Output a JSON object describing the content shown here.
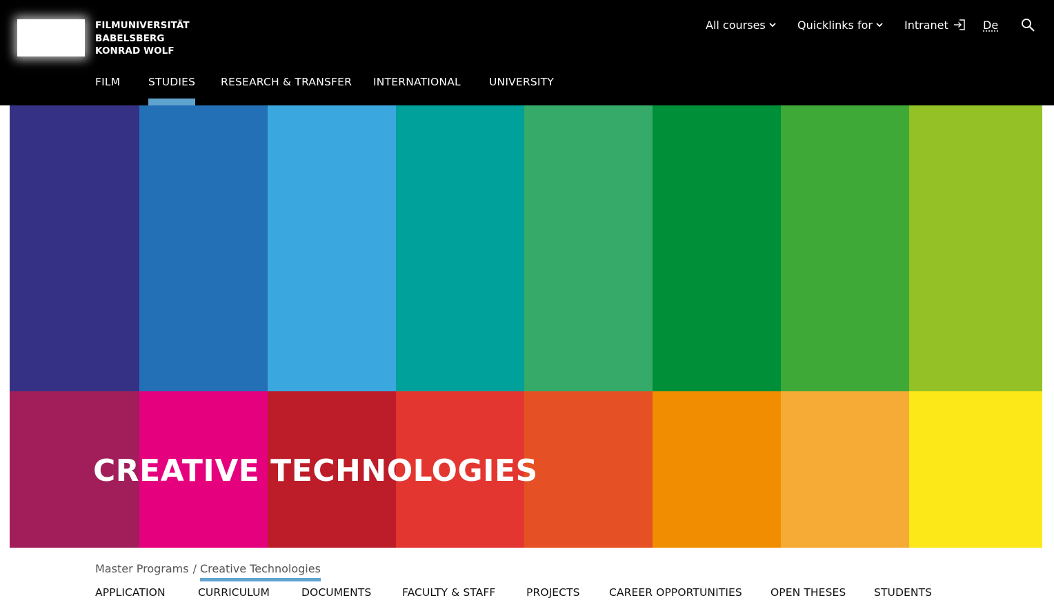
{
  "brand": {
    "line1": "FILMUNIVERSITÄT",
    "line2": "BABELSBERG",
    "line3": "KONRAD WOLF"
  },
  "utility_nav": {
    "all_courses": "All courses",
    "quicklinks": "Quicklinks for",
    "intranet": "Intranet",
    "language": "De",
    "icons": {
      "dropdown": "chevron-down-icon",
      "intranet": "login-icon",
      "search": "search-icon"
    }
  },
  "main_nav": {
    "items": [
      {
        "label": "FILM",
        "active": false
      },
      {
        "label": "STUDIES",
        "active": true
      },
      {
        "label": "RESEARCH & TRANSFER",
        "active": false
      },
      {
        "label": "INTERNATIONAL",
        "active": false
      },
      {
        "label": "UNIVERSITY",
        "active": false
      }
    ]
  },
  "hero": {
    "title": "CREATIVE TECHNOLOGIES",
    "top_colors": [
      "#353286",
      "#2470b6",
      "#3aa8df",
      "#00a19a",
      "#35aa69",
      "#008f39",
      "#3fa937",
      "#93c126"
    ],
    "bottom_colors": [
      "#a21e5a",
      "#e5007e",
      "#bc1d29",
      "#e33630",
      "#e55124",
      "#f18d00",
      "#f6ab37",
      "#fce818"
    ]
  },
  "breadcrumb": {
    "parent": "Master Programs",
    "separator": "/",
    "current": "Creative Technologies"
  },
  "sub_nav": {
    "items": [
      "APPLICATION",
      "CURRICULUM",
      "DOCUMENTS",
      "FACULTY & STAFF",
      "PROJECTS",
      "CAREER OPPORTUNITIES",
      "OPEN THESES",
      "STUDENTS"
    ]
  },
  "colors": {
    "header_bg": "#000000",
    "accent": "#5fa3cf",
    "breadcrumb_text": "#555555",
    "subnav_text": "#111111"
  }
}
